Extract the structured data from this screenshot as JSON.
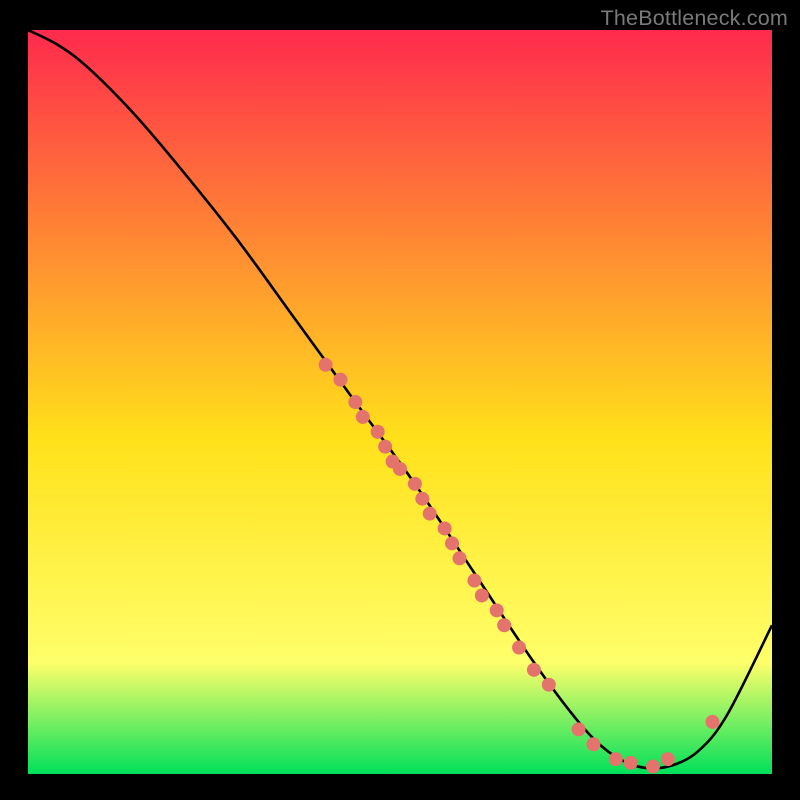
{
  "watermark": "TheBottleneck.com",
  "chart_data": {
    "type": "line",
    "title": "",
    "xlabel": "",
    "ylabel": "",
    "xlim": [
      0,
      100
    ],
    "ylim": [
      0,
      100
    ],
    "grid": false,
    "legend": false,
    "background_gradient": {
      "top": "#ff2a4d",
      "middle": "#ffe11a",
      "lower": "#ffff6a",
      "bottom": "#00e05a"
    },
    "series": [
      {
        "name": "bottleneck-curve",
        "color": "#000000",
        "x": [
          0,
          4,
          8,
          14,
          20,
          28,
          36,
          44,
          52,
          60,
          68,
          74,
          78,
          82,
          86,
          90,
          94,
          100
        ],
        "y": [
          100,
          98,
          95,
          89,
          82,
          72,
          61,
          50,
          39,
          27,
          15,
          7,
          3,
          1,
          1,
          3,
          8,
          20
        ]
      }
    ],
    "points": [
      {
        "name": "marker",
        "x": 40,
        "y": 55
      },
      {
        "name": "marker",
        "x": 42,
        "y": 53
      },
      {
        "name": "marker",
        "x": 44,
        "y": 50
      },
      {
        "name": "marker",
        "x": 45,
        "y": 48
      },
      {
        "name": "marker",
        "x": 47,
        "y": 46
      },
      {
        "name": "marker",
        "x": 48,
        "y": 44
      },
      {
        "name": "marker",
        "x": 49,
        "y": 42
      },
      {
        "name": "marker",
        "x": 50,
        "y": 41
      },
      {
        "name": "marker",
        "x": 52,
        "y": 39
      },
      {
        "name": "marker",
        "x": 53,
        "y": 37
      },
      {
        "name": "marker",
        "x": 54,
        "y": 35
      },
      {
        "name": "marker",
        "x": 56,
        "y": 33
      },
      {
        "name": "marker",
        "x": 57,
        "y": 31
      },
      {
        "name": "marker",
        "x": 58,
        "y": 29
      },
      {
        "name": "marker",
        "x": 60,
        "y": 26
      },
      {
        "name": "marker",
        "x": 61,
        "y": 24
      },
      {
        "name": "marker",
        "x": 63,
        "y": 22
      },
      {
        "name": "marker",
        "x": 64,
        "y": 20
      },
      {
        "name": "marker",
        "x": 66,
        "y": 17
      },
      {
        "name": "marker",
        "x": 68,
        "y": 14
      },
      {
        "name": "marker",
        "x": 70,
        "y": 12
      },
      {
        "name": "marker",
        "x": 74,
        "y": 6
      },
      {
        "name": "marker",
        "x": 76,
        "y": 4
      },
      {
        "name": "marker",
        "x": 79,
        "y": 2
      },
      {
        "name": "marker",
        "x": 81,
        "y": 1.5
      },
      {
        "name": "marker",
        "x": 84,
        "y": 1
      },
      {
        "name": "marker",
        "x": 86,
        "y": 2
      },
      {
        "name": "marker",
        "x": 92,
        "y": 7
      }
    ],
    "point_style": {
      "color": "#e4736c",
      "radius": 7
    }
  }
}
